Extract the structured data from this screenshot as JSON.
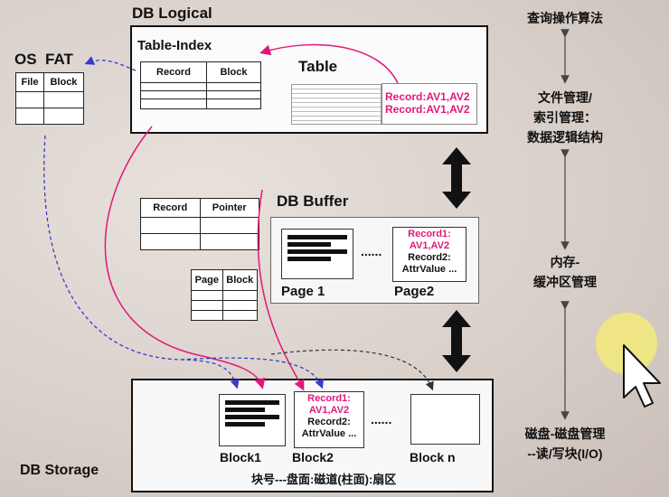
{
  "diagram": {
    "db_logical": {
      "title": "DB Logical",
      "table_index_title": "Table-Index",
      "table_index_headers": [
        "Record",
        "Block"
      ],
      "table_title": "Table",
      "table_records": [
        "Record:AV1,AV2",
        "Record:AV1,AV2"
      ]
    },
    "os_fat": {
      "title": "OS  FAT",
      "headers": [
        "File",
        "Block"
      ]
    },
    "record_pointer": {
      "headers": [
        "Record",
        "Pointer"
      ]
    },
    "page_block": {
      "headers": [
        "Page",
        "Block"
      ]
    },
    "db_buffer": {
      "title": "DB Buffer",
      "page1_label": "Page 1",
      "page2_label": "Page2",
      "ellipsis": "......",
      "page2_lines": [
        "Record1:",
        "AV1,AV2",
        "Record2:",
        "AttrValue ..."
      ]
    },
    "db_storage": {
      "title": "DB Storage",
      "block1_label": "Block1",
      "block2_label": "Block2",
      "blockn_label": "Block n",
      "ellipsis": "......",
      "block2_lines": [
        "Record1:",
        "AV1,AV2",
        "Record2:",
        "AttrValue ..."
      ],
      "address_caption": "块号---盘面:磁道(柱面):扇区"
    },
    "right_labels": {
      "query": "查询操作算法",
      "file_mgmt_1": "文件管理/",
      "file_mgmt_2": "索引管理：",
      "file_mgmt_3": "数据逻辑结构",
      "memory_1": "内存-",
      "memory_2": "缓冲区管理",
      "disk_1": "磁盘-磁盘管理",
      "disk_2": "--读/写块(I/O)"
    },
    "colors": {
      "accent": "#e0187a",
      "dashed_link": "#3a3acc"
    }
  }
}
